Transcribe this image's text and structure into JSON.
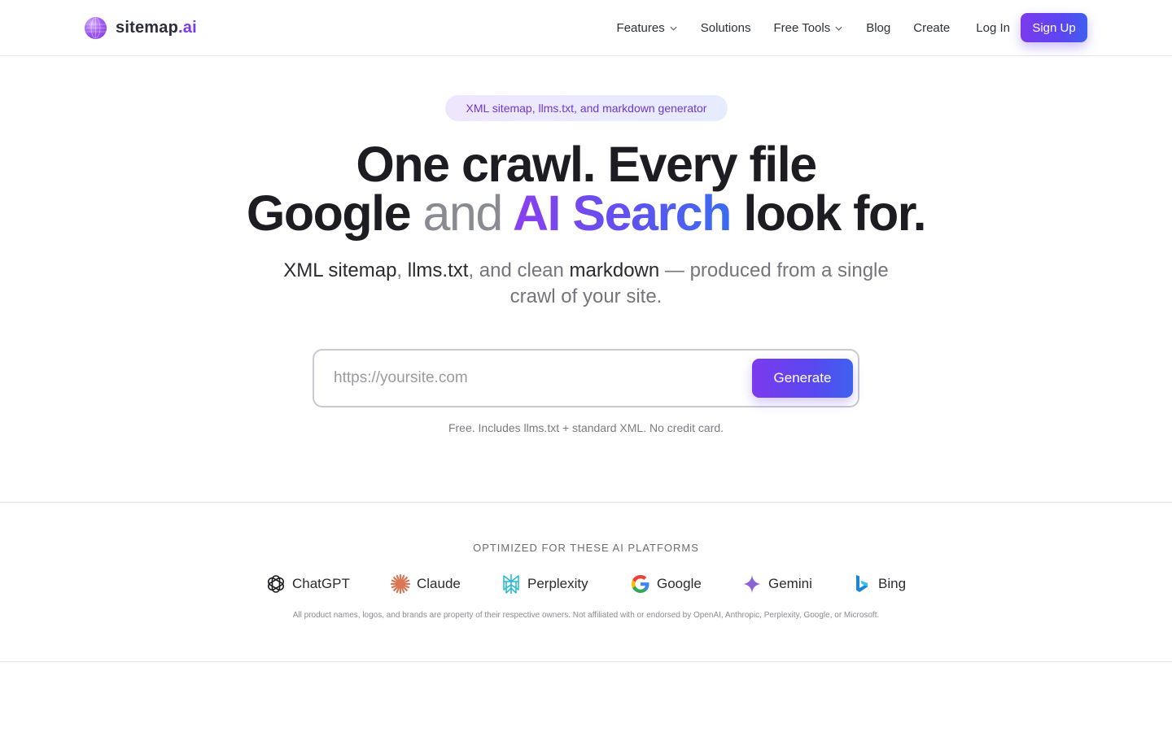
{
  "header": {
    "logo": {
      "name": "sitemap",
      "suffix": ".ai"
    },
    "nav": [
      {
        "label": "Features",
        "has_dropdown": true
      },
      {
        "label": "Solutions",
        "has_dropdown": false
      },
      {
        "label": "Free Tools",
        "has_dropdown": true
      },
      {
        "label": "Blog",
        "has_dropdown": false
      },
      {
        "label": "Create",
        "has_dropdown": false
      }
    ],
    "login_label": "Log In",
    "signup_label": "Sign Up"
  },
  "hero": {
    "pill": "XML sitemap, llms.txt, and markdown generator",
    "headline_line1": "One crawl. Every file",
    "headline_google": "Google",
    "headline_and": "and",
    "headline_ai": "AI Search",
    "headline_end": "look for.",
    "sub_1": "XML sitemap",
    "sub_2": ", ",
    "sub_3": "llms.txt",
    "sub_4": ", and clean ",
    "sub_5": "markdown",
    "sub_6": " — produced from a single crawl of your site.",
    "input_placeholder": "https://yoursite.com",
    "generate_label": "Generate",
    "note": "Free. Includes llms.txt + standard XML. No credit card."
  },
  "platforms": {
    "title": "OPTIMIZED FOR THESE AI PLATFORMS",
    "items": [
      {
        "name": "ChatGPT",
        "icon": "chatgpt-icon"
      },
      {
        "name": "Claude",
        "icon": "claude-icon"
      },
      {
        "name": "Perplexity",
        "icon": "perplexity-icon"
      },
      {
        "name": "Google",
        "icon": "google-icon"
      },
      {
        "name": "Gemini",
        "icon": "gemini-icon"
      },
      {
        "name": "Bing",
        "icon": "bing-icon"
      }
    ],
    "disclaimer": "All product names, logos, and brands are property of their respective owners. Not affiliated with or endorsed by OpenAI, Anthropic, Perplexity, Google, or Microsoft."
  },
  "colors": {
    "accent": "#7c3aed",
    "accent_blue": "#3f5ef0",
    "claude": "#d97757",
    "perplexity": "#20b8cd",
    "gemini": "#8a64d6",
    "bing": "#1a86d4"
  }
}
